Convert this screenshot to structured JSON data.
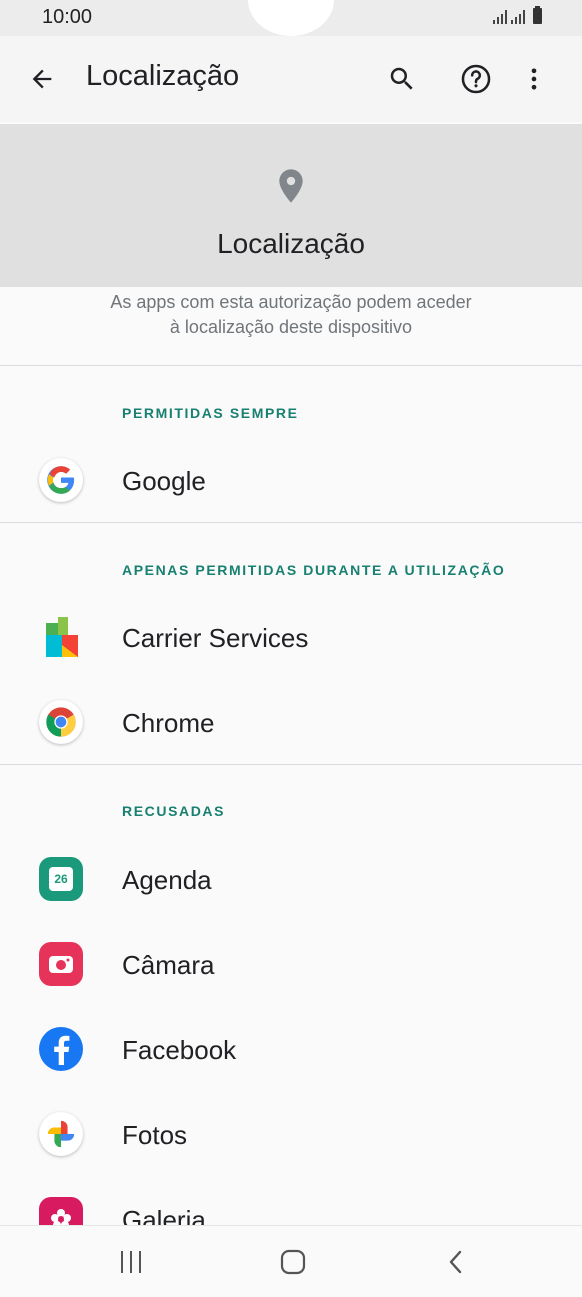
{
  "status": {
    "time": "10:00"
  },
  "appbar": {
    "title": "Localização",
    "back_icon": "arrow-left-icon",
    "search_icon": "search-icon",
    "help_icon": "help-icon",
    "more_icon": "more-vert-icon"
  },
  "header": {
    "title": "Localização",
    "icon": "location-pin-icon"
  },
  "description": {
    "line1": "As apps com esta autorização podem aceder",
    "line2": "à localização deste dispositivo"
  },
  "sections": {
    "always": {
      "title": "PERMITIDAS SEMPRE",
      "items": [
        {
          "label": "Google",
          "icon": "google-icon"
        }
      ]
    },
    "while_using": {
      "title": "APENAS PERMITIDAS DURANTE A UTILIZAÇÃO",
      "items": [
        {
          "label": "Carrier Services",
          "icon": "carrier-services-icon"
        },
        {
          "label": "Chrome",
          "icon": "chrome-icon"
        }
      ]
    },
    "denied": {
      "title": "RECUSADAS",
      "items": [
        {
          "label": "Agenda",
          "icon": "calendar-icon",
          "badge": "26"
        },
        {
          "label": "Câmara",
          "icon": "camera-icon"
        },
        {
          "label": "Facebook",
          "icon": "facebook-icon"
        },
        {
          "label": "Fotos",
          "icon": "photos-icon"
        },
        {
          "label": "Galeria",
          "icon": "gallery-icon"
        }
      ]
    }
  },
  "colors": {
    "accent": "#188070",
    "header_bg": "#e0e0e0"
  },
  "navbar": {
    "recents_icon": "recents-icon",
    "home_icon": "home-icon",
    "back_icon": "nav-back-icon"
  }
}
